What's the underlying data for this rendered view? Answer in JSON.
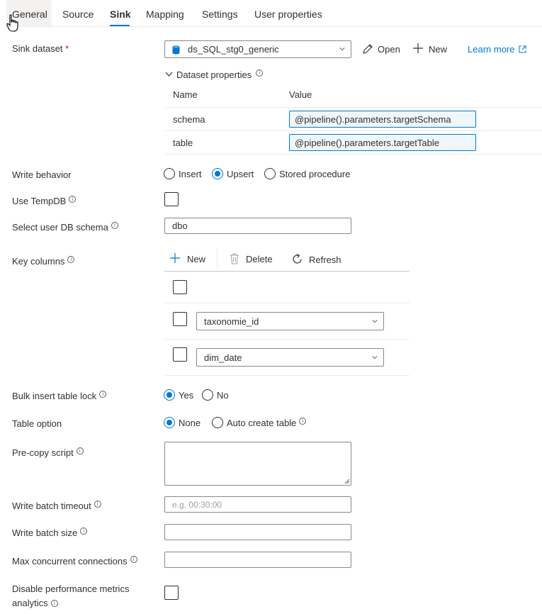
{
  "tabs": [
    {
      "label": "General"
    },
    {
      "label": "Source"
    },
    {
      "label": "Sink"
    },
    {
      "label": "Mapping"
    },
    {
      "label": "Settings"
    },
    {
      "label": "User properties"
    }
  ],
  "active_tab": "Sink",
  "sink_dataset": {
    "label": "Sink dataset",
    "required_mark": "*",
    "value": "ds_SQL_stg0_generic",
    "open_label": "Open",
    "new_label": "New",
    "learn_more_label": "Learn more"
  },
  "dataset_properties": {
    "title": "Dataset properties",
    "col_name": "Name",
    "col_value": "Value",
    "rows": [
      {
        "name": "schema",
        "value": "@pipeline().parameters.targetSchema"
      },
      {
        "name": "table",
        "value": "@pipeline().parameters.targetTable"
      }
    ]
  },
  "write_behavior": {
    "label": "Write behavior",
    "options": [
      "Insert",
      "Upsert",
      "Stored procedure"
    ],
    "selected": "Upsert"
  },
  "use_tempdb": {
    "label": "Use TempDB",
    "checked": false
  },
  "user_db_schema": {
    "label": "Select user DB schema",
    "value": "dbo"
  },
  "key_columns": {
    "label": "Key columns",
    "new_label": "New",
    "delete_label": "Delete",
    "refresh_label": "Refresh",
    "rows": [
      "taxonomie_id",
      "dim_date"
    ]
  },
  "bulk_insert_lock": {
    "label": "Bulk insert table lock",
    "options": [
      "Yes",
      "No"
    ],
    "selected": "Yes"
  },
  "table_option": {
    "label": "Table option",
    "options": [
      "None",
      "Auto create table"
    ],
    "selected": "None"
  },
  "pre_copy_script": {
    "label": "Pre-copy script",
    "value": ""
  },
  "write_batch_timeout": {
    "label": "Write batch timeout",
    "placeholder": "e.g. 00:30:00"
  },
  "write_batch_size": {
    "label": "Write batch size",
    "value": ""
  },
  "max_concurrent": {
    "label": "Max concurrent connections",
    "value": ""
  },
  "disable_metrics": {
    "label_line1": "Disable performance metrics",
    "label_line2": "analytics",
    "checked": false
  },
  "colors": {
    "accent": "#0078d4",
    "required": "#a4262c"
  }
}
